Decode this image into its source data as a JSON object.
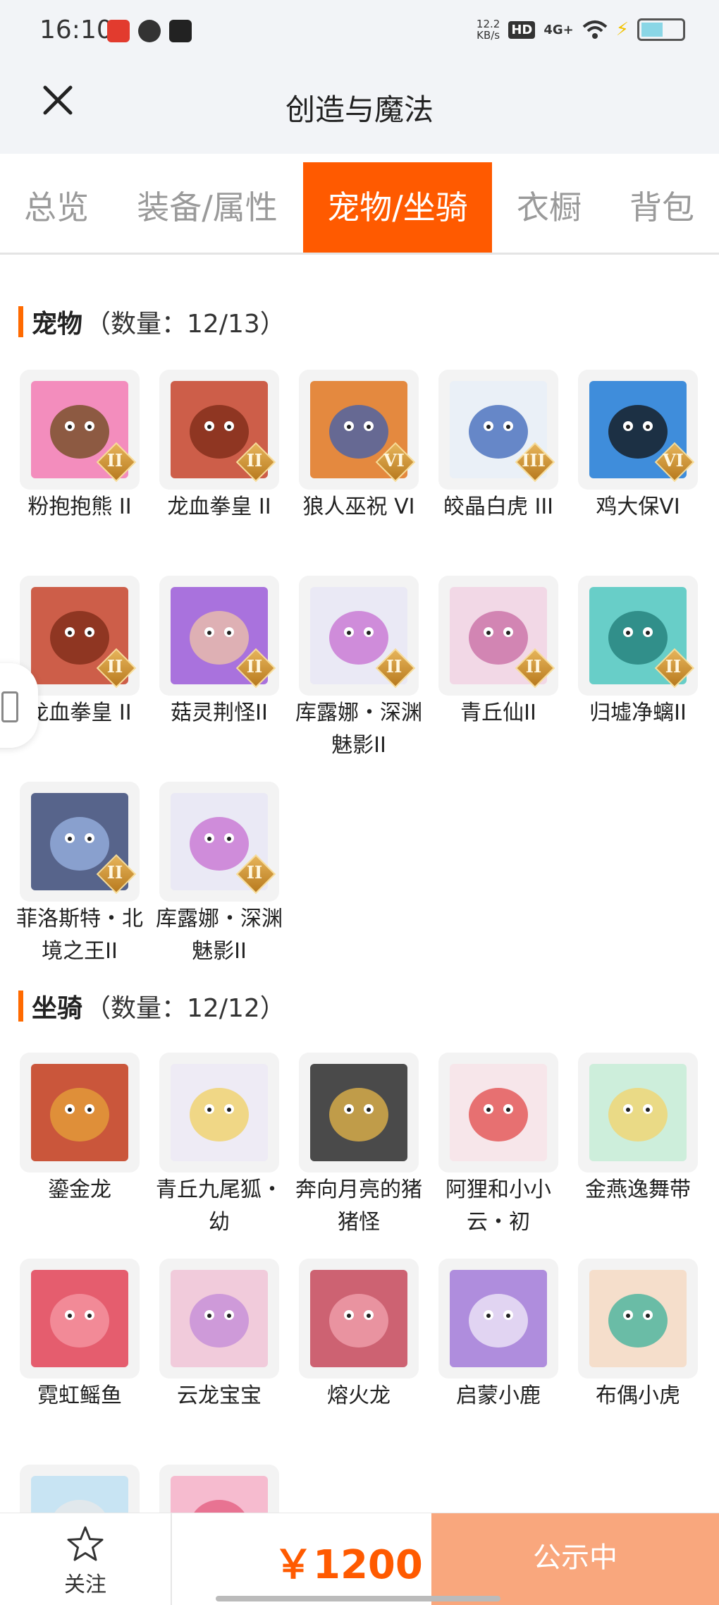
{
  "status_bar": {
    "time": "16:10",
    "speed_value": "12.2",
    "speed_unit": "KB/s",
    "hd": "HD",
    "network": "4G+"
  },
  "header": {
    "title": "创造与魔法"
  },
  "tabs": [
    {
      "label": "总览",
      "active": false
    },
    {
      "label": "装备/属性",
      "active": false
    },
    {
      "label": "宠物/坐骑",
      "active": true
    },
    {
      "label": "衣橱",
      "active": false
    },
    {
      "label": "背包",
      "active": false
    }
  ],
  "pets": {
    "title": "宠物",
    "count": "（数量：12/13）",
    "items": [
      {
        "name": "粉抱抱熊 II",
        "badge": "II"
      },
      {
        "name": "龙血拳皇 II",
        "badge": "II"
      },
      {
        "name": "狼人巫祝 VI",
        "badge": "VI"
      },
      {
        "name": "皎晶白虎 III",
        "badge": "III"
      },
      {
        "name": "鸡大保VI",
        "badge": "VI"
      },
      {
        "name": "龙血拳皇 II",
        "badge": "II"
      },
      {
        "name": "菇灵荆怪II",
        "badge": "II"
      },
      {
        "name": "库露娜・深渊魅影II",
        "badge": "II"
      },
      {
        "name": "青丘仙II",
        "badge": "II"
      },
      {
        "name": "归墟净螭II",
        "badge": "II"
      },
      {
        "name": "菲洛斯特・北境之王II",
        "badge": "II"
      },
      {
        "name": "库露娜・深渊魅影II",
        "badge": "II"
      }
    ]
  },
  "mounts": {
    "title": "坐骑",
    "count": "（数量：12/12）",
    "items": [
      {
        "name": "鎏金龙"
      },
      {
        "name": "青丘九尾狐・幼"
      },
      {
        "name": "奔向月亮的猪猪怪"
      },
      {
        "name": "阿狸和小小云・初"
      },
      {
        "name": "金燕逸舞带"
      },
      {
        "name": "霓虹鳐鱼"
      },
      {
        "name": "云龙宝宝"
      },
      {
        "name": "熔火龙"
      },
      {
        "name": "启蒙小鹿"
      },
      {
        "name": "布偶小虎"
      },
      {
        "name": ""
      },
      {
        "name": ""
      }
    ]
  },
  "bottom": {
    "follow_label": "关注",
    "price": "￥1200",
    "status_label": "公示中"
  },
  "colors": {
    "accent": "#ff5a00",
    "status_button": "#f9a77d",
    "badge_gold": "#c98a2a"
  }
}
